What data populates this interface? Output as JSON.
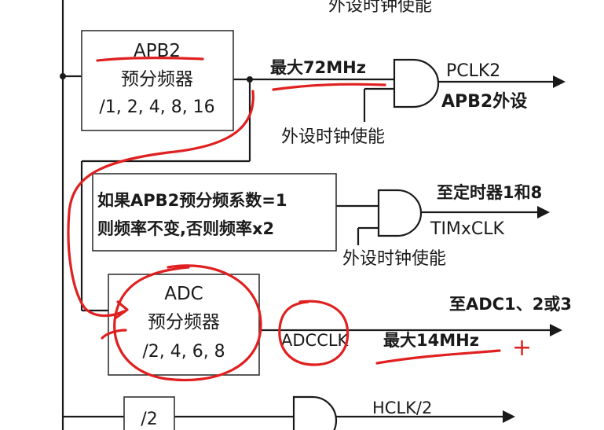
{
  "top_enable_label": "外设时钟使能",
  "apb2_prescaler": {
    "title": "APB2",
    "subtitle": "预分频器",
    "ratios": "/1, 2, 4, 8, 16"
  },
  "apb2_max_label": "最大72MHz",
  "pclk2": {
    "signal": "PCLK2",
    "target": "APB2外设",
    "enable": "外设时钟使能"
  },
  "timer_multiplier": {
    "line1": "如果APB2预分频系数=1",
    "line2": "则频率不变,否则频率x2"
  },
  "timer_clk": {
    "target": "至定时器1和8",
    "signal": "TIMxCLK",
    "enable": "外设时钟使能"
  },
  "adc_prescaler": {
    "title": "ADC",
    "subtitle": "预分频器",
    "ratios": "/2, 4, 6, 8"
  },
  "adc_output": {
    "target": "至ADC1、2或3",
    "signal": "ADCCLK",
    "max": "最大14MHz",
    "plus_mark": "+"
  },
  "hclk_divider": {
    "ratio": "/2",
    "signal": "HCLK/2"
  },
  "colors": {
    "ink": "#1a1a1a",
    "annotation_red": "#e02020"
  }
}
